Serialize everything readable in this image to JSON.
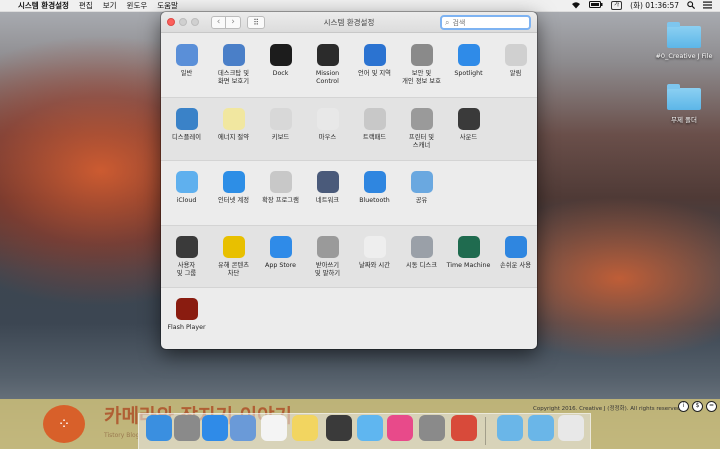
{
  "menubar": {
    "apple": "",
    "app_name": "시스템 환경설정",
    "menus": [
      "편집",
      "보기",
      "윈도우",
      "도움말"
    ],
    "input_source": "가",
    "clock": "(화) 01:36:57"
  },
  "desktop": {
    "items": [
      {
        "label": "#0_Creative J File"
      },
      {
        "label": "무제 폴더"
      }
    ]
  },
  "window": {
    "title": "시스템 환경설정",
    "search_placeholder": "검색",
    "sections": [
      [
        {
          "label": "일반",
          "icon": "general-icon",
          "color": "#5a8fd8"
        },
        {
          "label": "데스크탑 및\n화면 보호기",
          "icon": "desktop-screensaver-icon",
          "color": "#4a7fc8"
        },
        {
          "label": "Dock",
          "icon": "dock-icon",
          "color": "#1c1c1c"
        },
        {
          "label": "Mission\nControl",
          "icon": "mission-control-icon",
          "color": "#2b2b2b"
        },
        {
          "label": "언어 및 지역",
          "icon": "language-region-icon",
          "color": "#2b73d1"
        },
        {
          "label": "보안 및\n개인 정보 보호",
          "icon": "security-privacy-icon",
          "color": "#8a8a8a"
        },
        {
          "label": "Spotlight",
          "icon": "spotlight-icon",
          "color": "#2f8be8"
        },
        {
          "label": "알림",
          "icon": "notifications-icon",
          "color": "#d0d0d0"
        }
      ],
      [
        {
          "label": "디스플레이",
          "icon": "displays-icon",
          "color": "#3a82c8"
        },
        {
          "label": "에너지 절약",
          "icon": "energy-saver-icon",
          "color": "#f1e7a0"
        },
        {
          "label": "키보드",
          "icon": "keyboard-icon",
          "color": "#d8d8d8"
        },
        {
          "label": "마우스",
          "icon": "mouse-icon",
          "color": "#e8e8e8"
        },
        {
          "label": "트랙패드",
          "icon": "trackpad-icon",
          "color": "#c8c8c8"
        },
        {
          "label": "프린터 및\n스캐너",
          "icon": "printers-scanners-icon",
          "color": "#9a9a9a"
        },
        {
          "label": "사운드",
          "icon": "sound-icon",
          "color": "#3a3a3a"
        }
      ],
      [
        {
          "label": "iCloud",
          "icon": "icloud-icon",
          "color": "#5fb0ee"
        },
        {
          "label": "인터넷 계정",
          "icon": "internet-accounts-icon",
          "color": "#2d8ee6"
        },
        {
          "label": "확장 프로그램",
          "icon": "extensions-icon",
          "color": "#c8c8c8"
        },
        {
          "label": "네트워크",
          "icon": "network-icon",
          "color": "#4a5a7a"
        },
        {
          "label": "Bluetooth",
          "icon": "bluetooth-icon",
          "color": "#2f86e0"
        },
        {
          "label": "공유",
          "icon": "sharing-icon",
          "color": "#6aa8e0"
        }
      ],
      [
        {
          "label": "사용자\n및 그룹",
          "icon": "users-groups-icon",
          "color": "#3a3a3a"
        },
        {
          "label": "유해 콘텐츠\n차단",
          "icon": "parental-controls-icon",
          "color": "#e8c000"
        },
        {
          "label": "App Store",
          "icon": "app-store-icon",
          "color": "#2f8be8"
        },
        {
          "label": "받아쓰기\n및 말하기",
          "icon": "dictation-speech-icon",
          "color": "#9a9a9a"
        },
        {
          "label": "날짜와 시간",
          "icon": "date-time-icon",
          "color": "#eeeeee"
        },
        {
          "label": "시동 디스크",
          "icon": "startup-disk-icon",
          "color": "#9aa0a8"
        },
        {
          "label": "Time Machine",
          "icon": "time-machine-icon",
          "color": "#1f6b4f"
        },
        {
          "label": "손쉬운 사용",
          "icon": "accessibility-icon",
          "color": "#2f86e0"
        }
      ],
      [
        {
          "label": "Flash Player",
          "icon": "flash-player-icon",
          "color": "#8a1c10"
        }
      ]
    ]
  },
  "dock_overlay": {
    "blog_title": "카메라와 잡지기 이야기",
    "blog_subtitle": "Tistory Blog",
    "copyright": "Copyright 2016. Creative J (정정화). All rights reserved."
  },
  "dock": {
    "apps": [
      {
        "name": "finder-icon",
        "color": "#3a8fe0"
      },
      {
        "name": "launchpad-icon",
        "color": "#8a8a8a"
      },
      {
        "name": "safari-icon",
        "color": "#2f8be8"
      },
      {
        "name": "preview-icon",
        "color": "#6a9ad8"
      },
      {
        "name": "calendar-icon",
        "color": "#f4f4f4"
      },
      {
        "name": "notes-icon",
        "color": "#f2d560"
      },
      {
        "name": "final-cut-icon",
        "color": "#3a3a3a"
      },
      {
        "name": "messages-icon",
        "color": "#5fb6f0"
      },
      {
        "name": "itunes-icon",
        "color": "#e84a8a"
      },
      {
        "name": "system-preferences-icon",
        "color": "#8a8a8a"
      },
      {
        "name": "creative-cloud-icon",
        "color": "#d84a3a"
      },
      {
        "name": "downloads-folder-icon",
        "color": "#6ab6e8"
      },
      {
        "name": "documents-folder-icon",
        "color": "#6ab6e8"
      },
      {
        "name": "trash-icon",
        "color": "#e8e8e8"
      }
    ]
  }
}
